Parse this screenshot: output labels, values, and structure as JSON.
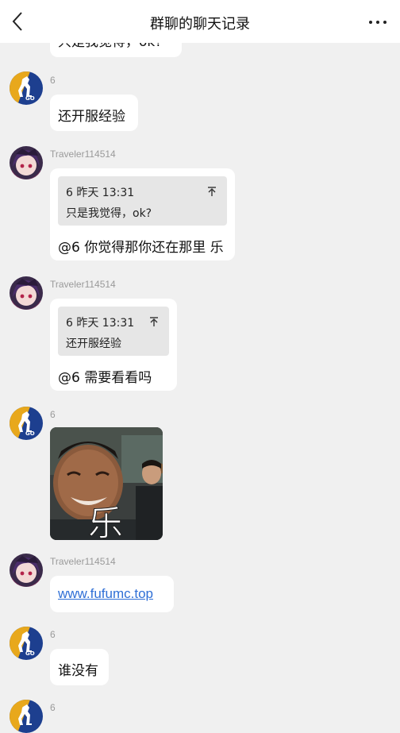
{
  "header": {
    "title": "群聊的聊天记录",
    "back_icon": "chevron-left-icon",
    "more_icon": "more-horizontal-icon"
  },
  "messages": [
    {
      "text": "只是我觉得，ok?"
    },
    {
      "sender": "6",
      "text": "还开服经验"
    },
    {
      "sender": "Traveler114514",
      "quote": {
        "meta": "6 昨天 13:31",
        "text": "只是我觉得，ok?"
      },
      "text": "@6 你觉得那你还在那里 乐"
    },
    {
      "sender": "Traveler114514",
      "quote": {
        "meta": "6 昨天 13:31",
        "text": "还开服经验"
      },
      "text": "@6 需要看看吗"
    },
    {
      "sender": "6",
      "sticker_caption": "乐"
    },
    {
      "sender": "Traveler114514",
      "link": "www.fufumc.top"
    },
    {
      "sender": "6",
      "text": "谁没有"
    },
    {
      "sender": "6"
    }
  ],
  "colors": {
    "link": "#2f6fd6",
    "background": "#f0f0f0",
    "bubble": "#ffffff",
    "quote_bg": "#e6e6e6"
  }
}
